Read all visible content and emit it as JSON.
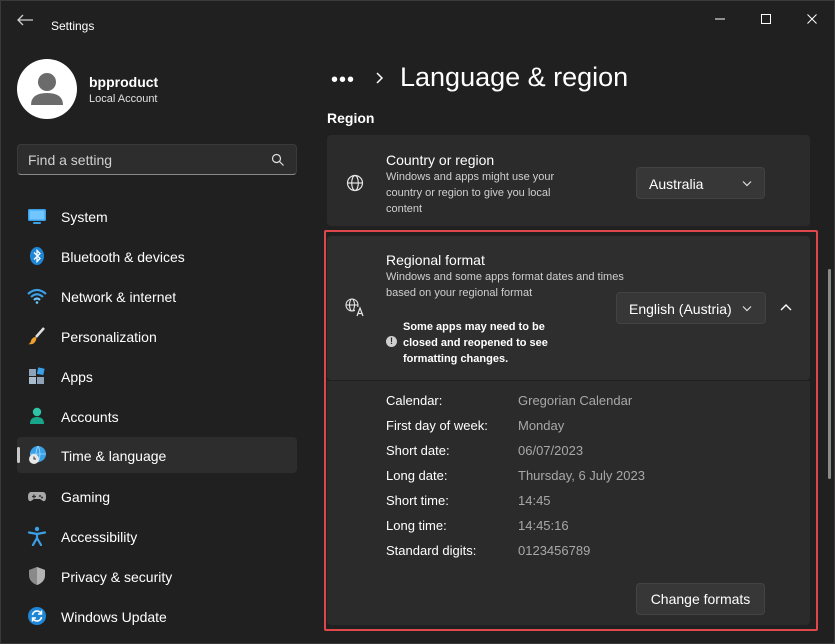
{
  "window": {
    "title": "Settings"
  },
  "profile": {
    "name": "bpproduct",
    "account_type": "Local Account"
  },
  "search": {
    "placeholder": "Find a setting"
  },
  "nav": [
    {
      "label": "System",
      "icon": "monitor-icon",
      "active": false
    },
    {
      "label": "Bluetooth & devices",
      "icon": "bluetooth-icon",
      "active": false
    },
    {
      "label": "Network & internet",
      "icon": "wifi-icon",
      "active": false
    },
    {
      "label": "Personalization",
      "icon": "paintbrush-icon",
      "active": false
    },
    {
      "label": "Apps",
      "icon": "apps-icon",
      "active": false
    },
    {
      "label": "Accounts",
      "icon": "person-icon",
      "active": false
    },
    {
      "label": "Time & language",
      "icon": "globe-clock-icon",
      "active": true
    },
    {
      "label": "Gaming",
      "icon": "gamepad-icon",
      "active": false
    },
    {
      "label": "Accessibility",
      "icon": "accessibility-icon",
      "active": false
    },
    {
      "label": "Privacy & security",
      "icon": "shield-icon",
      "active": false
    },
    {
      "label": "Windows Update",
      "icon": "update-icon",
      "active": false
    }
  ],
  "header": {
    "breadcrumb_more": "•••",
    "title": "Language & region"
  },
  "region": {
    "section_title": "Region",
    "country": {
      "title": "Country or region",
      "description": "Windows and apps might use your country or region to give you local content",
      "value": "Australia"
    },
    "format": {
      "title": "Regional format",
      "description": "Windows and some apps format dates and times based on your regional format",
      "note": "Some apps may need to be closed and reopened to see formatting changes.",
      "value": "English (Austria)",
      "details": [
        {
          "label": "Calendar:",
          "value": "Gregorian Calendar"
        },
        {
          "label": "First day of week:",
          "value": "Monday"
        },
        {
          "label": "Short date:",
          "value": "06/07/2023"
        },
        {
          "label": "Long date:",
          "value": "Thursday, 6 July 2023"
        },
        {
          "label": "Short time:",
          "value": "14:45"
        },
        {
          "label": "Long time:",
          "value": "14:45:16"
        },
        {
          "label": "Standard digits:",
          "value": "0123456789"
        }
      ],
      "change_button": "Change formats"
    }
  },
  "colors": {
    "background": "#202020",
    "card": "#2b2b2b",
    "highlight": "#e0474c",
    "accent": "#4cc2ff"
  }
}
